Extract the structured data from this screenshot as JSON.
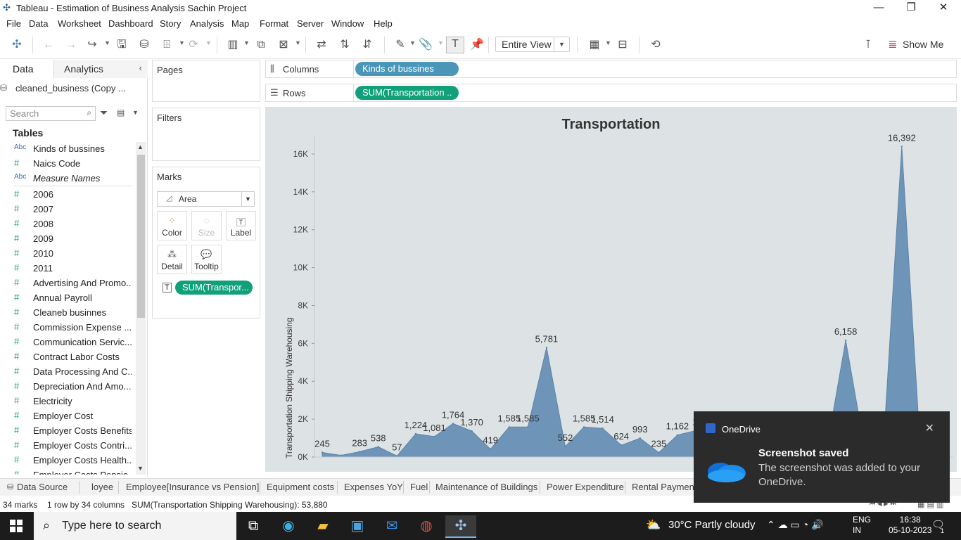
{
  "window": {
    "title": "Tableau - Estimation of Business Analysis Sachin Project"
  },
  "menu": [
    "File",
    "Data",
    "Worksheet",
    "Dashboard",
    "Story",
    "Analysis",
    "Map",
    "Format",
    "Server",
    "Window",
    "Help"
  ],
  "toolbar": {
    "fit": "Entire View",
    "show_me": "Show Me"
  },
  "data_pane": {
    "tab_data": "Data",
    "tab_analytics": "Analytics",
    "datasource": "cleaned_business (Copy ...",
    "search_placeholder": "Search",
    "tables_label": "Tables",
    "fields": [
      {
        "name": "Kinds of bussines",
        "type": "Abc"
      },
      {
        "name": "Naics Code",
        "type": "#"
      },
      {
        "name": "Measure Names",
        "type": "Abc"
      },
      {
        "name": "2006",
        "type": "#"
      },
      {
        "name": "2007",
        "type": "#"
      },
      {
        "name": "2008",
        "type": "#"
      },
      {
        "name": "2009",
        "type": "#"
      },
      {
        "name": "2010",
        "type": "#"
      },
      {
        "name": "2011",
        "type": "#"
      },
      {
        "name": "Advertising And Promo...",
        "type": "#"
      },
      {
        "name": "Annual Payroll",
        "type": "#"
      },
      {
        "name": "Cleaneb businnes",
        "type": "#"
      },
      {
        "name": "Commission Expense ...",
        "type": "#"
      },
      {
        "name": "Communication Servic...",
        "type": "#"
      },
      {
        "name": "Contract Labor Costs",
        "type": "#"
      },
      {
        "name": "Data Processing And C...",
        "type": "#"
      },
      {
        "name": "Depreciation And Amo...",
        "type": "#"
      },
      {
        "name": "Electricity",
        "type": "#"
      },
      {
        "name": "Employer Cost",
        "type": "#"
      },
      {
        "name": "Employer Costs Benefits",
        "type": "#"
      },
      {
        "name": "Employer Costs Contri...",
        "type": "#"
      },
      {
        "name": "Employer Costs Health...",
        "type": "#"
      },
      {
        "name": "Employer Costs Pensio...",
        "type": "#"
      }
    ]
  },
  "cards": {
    "pages": "Pages",
    "filters": "Filters",
    "marks": "Marks",
    "mark_type": "Area",
    "mark_buttons": [
      "Color",
      "Size",
      "Label",
      "Detail",
      "Tooltip"
    ],
    "mark_pill": "SUM(Transpor..."
  },
  "shelves": {
    "columns_label": "Columns",
    "columns_pill": "Kinds of bussines",
    "rows_label": "Rows",
    "rows_pill": "SUM(Transportation .."
  },
  "chart_data": {
    "type": "area",
    "title": "Transportation",
    "ylabel": "Transportation Shipping Warehousing",
    "yticks": [
      "0K",
      "2K",
      "4K",
      "6K",
      "8K",
      "10K",
      "12K",
      "14K",
      "16K"
    ],
    "ylim": [
      0,
      17000
    ],
    "color": "#6e94b8",
    "values": [
      245,
      90,
      283,
      538,
      57,
      1224,
      1081,
      1764,
      1370,
      419,
      1585,
      1585,
      5781,
      552,
      1585,
      1514,
      624,
      993,
      235,
      1162,
      1400,
      300,
      500,
      400,
      300,
      500,
      1000,
      500,
      6158,
      500,
      300,
      16392,
      300,
      100
    ],
    "labels": [
      {
        "i": 0,
        "text": "245"
      },
      {
        "i": 2,
        "text": "283"
      },
      {
        "i": 3,
        "text": "538"
      },
      {
        "i": 4,
        "text": "57"
      },
      {
        "i": 5,
        "text": "1,224"
      },
      {
        "i": 6,
        "text": "1,081"
      },
      {
        "i": 7,
        "text": "1,764"
      },
      {
        "i": 8,
        "text": "1,370"
      },
      {
        "i": 9,
        "text": "419"
      },
      {
        "i": 10,
        "text": "1,585"
      },
      {
        "i": 11,
        "text": "1,585"
      },
      {
        "i": 12,
        "text": "5,781"
      },
      {
        "i": 13,
        "text": "552"
      },
      {
        "i": 14,
        "text": "1,585"
      },
      {
        "i": 15,
        "text": "1,514"
      },
      {
        "i": 16,
        "text": "624"
      },
      {
        "i": 17,
        "text": "993"
      },
      {
        "i": 18,
        "text": "235"
      },
      {
        "i": 19,
        "text": "1,162"
      },
      {
        "i": 20,
        "text": "1,"
      },
      {
        "i": 28,
        "text": "6,158"
      },
      {
        "i": 31,
        "text": "16,392"
      }
    ]
  },
  "sheet_tabs": [
    "Data Source",
    "loyee",
    "Employee[Insurance vs Pension]",
    "Equipment costs",
    "Expenses YoY",
    "Fuel",
    "Maintenance of Buildings",
    "Power Expenditure",
    "Rental Payment"
  ],
  "status": {
    "marks": "34 marks",
    "dims": "1 row by 34 columns",
    "sum": "SUM(Transportation Shipping Warehousing): 53,880"
  },
  "toast": {
    "app": "OneDrive",
    "heading": "Screenshot saved",
    "message": "The screenshot was added to your OneDrive."
  },
  "taskbar": {
    "search_placeholder": "Type here to search",
    "weather": "30°C  Partly cloudy",
    "lang1": "ENG",
    "lang2": "IN",
    "time": "16:38",
    "date": "05-10-2023",
    "notif_count": "1"
  }
}
